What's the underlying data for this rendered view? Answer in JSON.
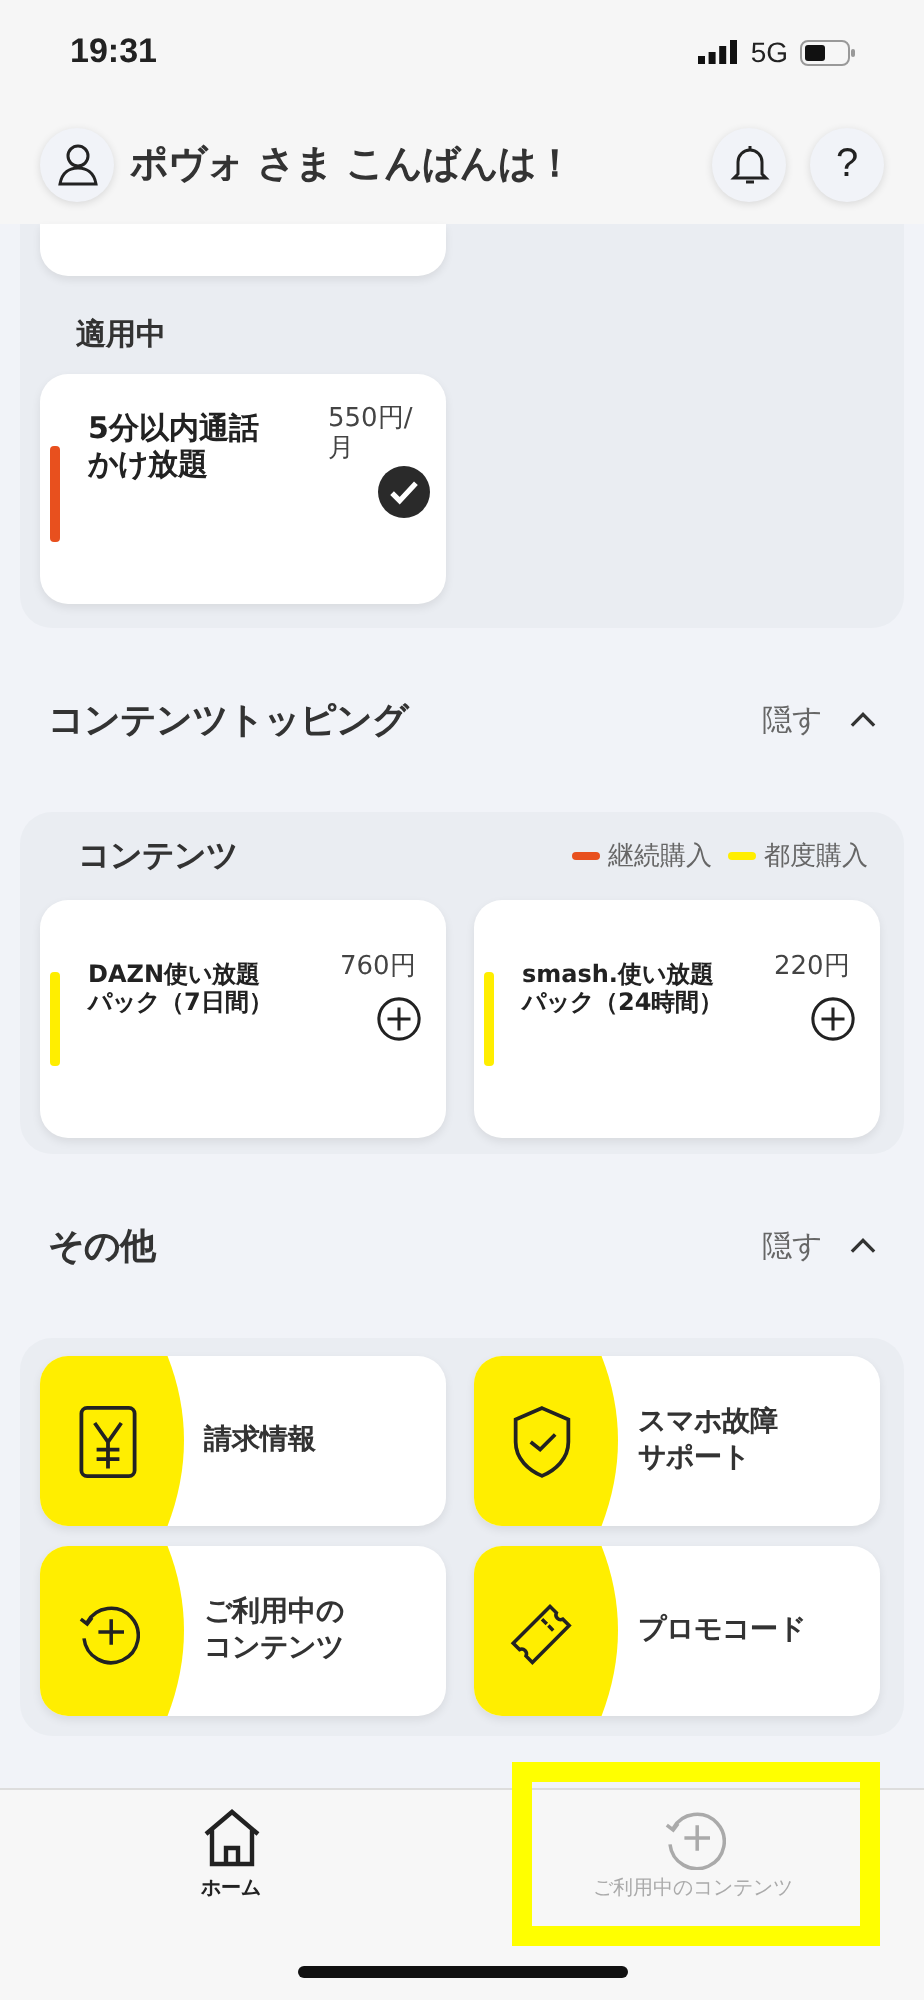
{
  "status_bar": {
    "time": "19:31",
    "network": "5G"
  },
  "header": {
    "greeting": "ポヴォ さま こんばんは！",
    "help": "?"
  },
  "plans": {
    "label": "適用中",
    "cards": [
      {
        "title": "5分以内通話かけ放題",
        "price": "550円/月",
        "color": "#e8501e",
        "checked": true
      }
    ]
  },
  "topping_section": {
    "title": "コンテンツトッピング",
    "toggle": "隠す",
    "expanded": true
  },
  "contents": {
    "label": "コンテンツ",
    "legend": [
      {
        "label": "継続購入",
        "color": "#e8501e"
      },
      {
        "label": "都度購入",
        "color": "#ffee00"
      }
    ],
    "items": [
      {
        "title": "DAZN使い放題パック（7日間）",
        "price": "760円",
        "color": "#ffee00"
      },
      {
        "title": "smash.使い放題パック（24時間）",
        "price": "220円",
        "color": "#ffee00"
      }
    ]
  },
  "other_section": {
    "title": "その他",
    "toggle": "隠す",
    "expanded": true
  },
  "other_items": [
    {
      "label": "請求情報",
      "kind": "yen"
    },
    {
      "label": "スマホ故障サポート",
      "kind": "shield"
    },
    {
      "label": "ご利用中のコンテンツ",
      "kind": "refresh-plus"
    },
    {
      "label": "プロモコード",
      "kind": "ticket"
    }
  ],
  "bottom_nav": [
    {
      "label": "ホーム",
      "kind": "home",
      "selected": true,
      "highlighted": false
    },
    {
      "label": "ご利用中のコンテンツ",
      "kind": "refresh-plus",
      "selected": false,
      "highlighted": true
    }
  ]
}
